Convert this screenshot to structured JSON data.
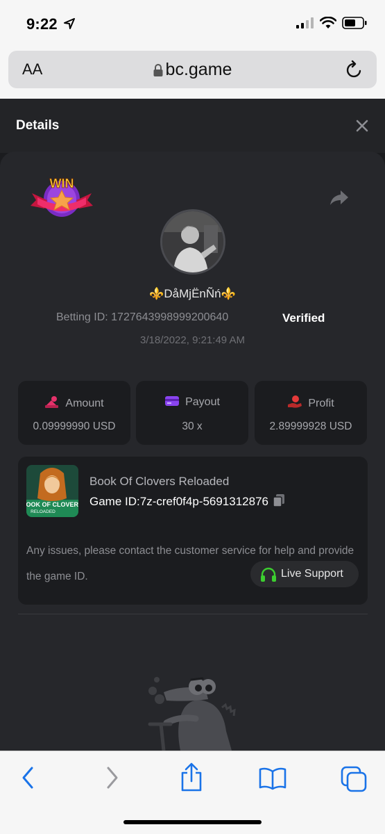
{
  "status_bar": {
    "time": "9:22"
  },
  "url_bar": {
    "aa_label": "AA",
    "url": "bc.game"
  },
  "details": {
    "title": "Details"
  },
  "bet": {
    "username": "⚜️DåMjËnÑń⚜️",
    "betting_id_label": "Betting ID: 1727643998999200640",
    "verified_label": "Verified",
    "datetime": "3/18/2022, 9:21:49 AM",
    "badge_text": "WIN"
  },
  "stats": [
    {
      "label": "Amount",
      "value": "0.09999990 USD",
      "icon": "amount-icon",
      "color": "#e5326b"
    },
    {
      "label": "Payout",
      "value": "30 x",
      "icon": "card-icon",
      "color": "#8a44f0"
    },
    {
      "label": "Profit",
      "value": "2.89999928 USD",
      "icon": "profit-icon",
      "color": "#e53a3a"
    }
  ],
  "game": {
    "name": "Book Of Clovers Reloaded",
    "game_id": "Game ID:7z-cref0f4p-5691312876",
    "thumb_title": "BOOK OF CLOVERS",
    "thumb_sub": "RELOADED"
  },
  "support": {
    "message": "Any issues, please contact the customer service for help and provide the game ID.",
    "button_label": "Live Support"
  },
  "colors": {
    "accent_green": "#3ccd30",
    "background": "#1b1c1f",
    "card": "#26272b",
    "ios_blue": "#1a73e8"
  }
}
